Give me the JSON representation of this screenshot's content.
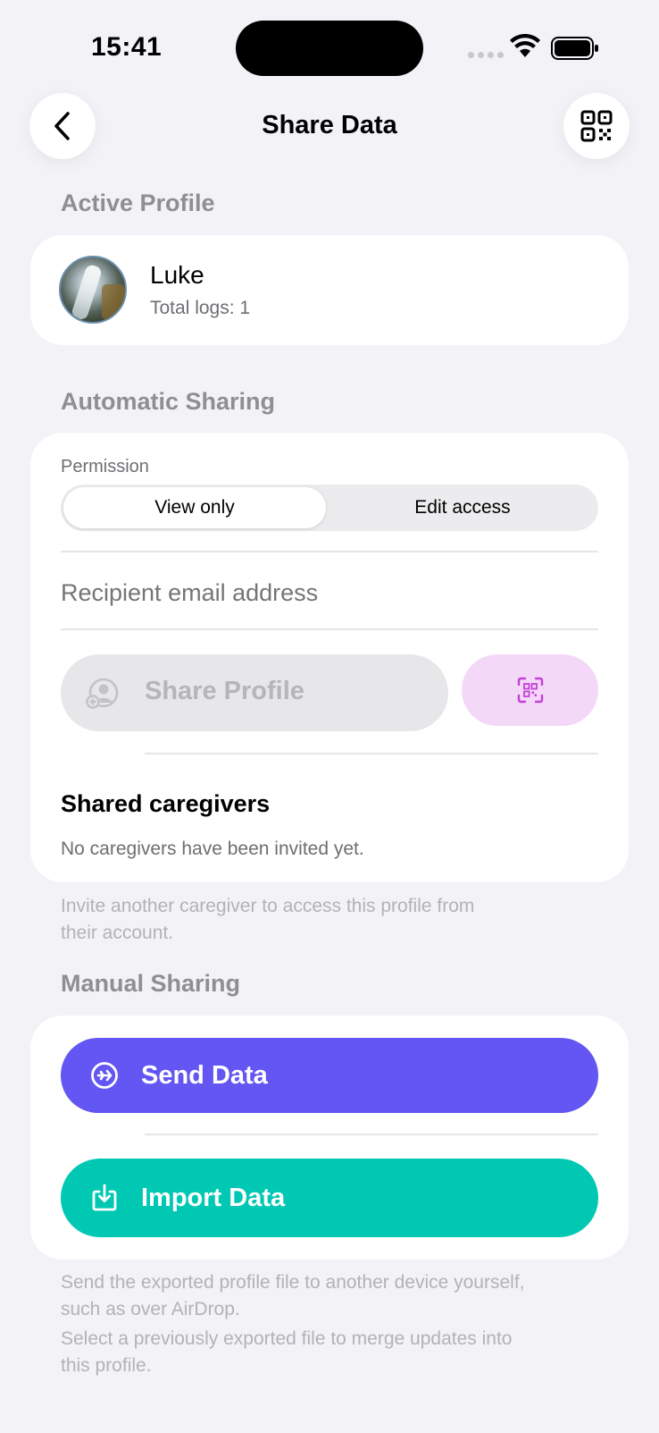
{
  "status_bar": {
    "time": "15:41"
  },
  "nav": {
    "title": "Share Data",
    "back_icon": "chevron-left-icon",
    "right_icon": "qr-code-icon"
  },
  "active_profile": {
    "section_title": "Active Profile",
    "name": "Luke",
    "logs": "Total logs: 1"
  },
  "automatic_sharing": {
    "section_title": "Automatic Sharing",
    "permission_label": "Permission",
    "permission_options": [
      "View only",
      "Edit access"
    ],
    "selected_permission": "View only",
    "email_placeholder": "Recipient email address",
    "share_button": "Share Profile",
    "shared_caregivers_title": "Shared caregivers",
    "shared_caregivers_empty": "No caregivers have been invited yet.",
    "footnote_line1": "Invite another caregiver to access this profile from",
    "footnote_line2": "their account."
  },
  "manual_sharing": {
    "section_title": "Manual Sharing",
    "send_button": "Send Data",
    "import_button": "Import Data",
    "footnote1_line1": "Send the exported profile file to another device yourself,",
    "footnote1_line2": "such as over AirDrop.",
    "footnote2_line1": "Select a previously exported file to merge updates into",
    "footnote2_line2": "this profile."
  },
  "colors": {
    "send": "#6356f2",
    "import": "#00c8b3",
    "scan_bg": "#f3d8f7",
    "scan_icon": "#c53fd9"
  }
}
